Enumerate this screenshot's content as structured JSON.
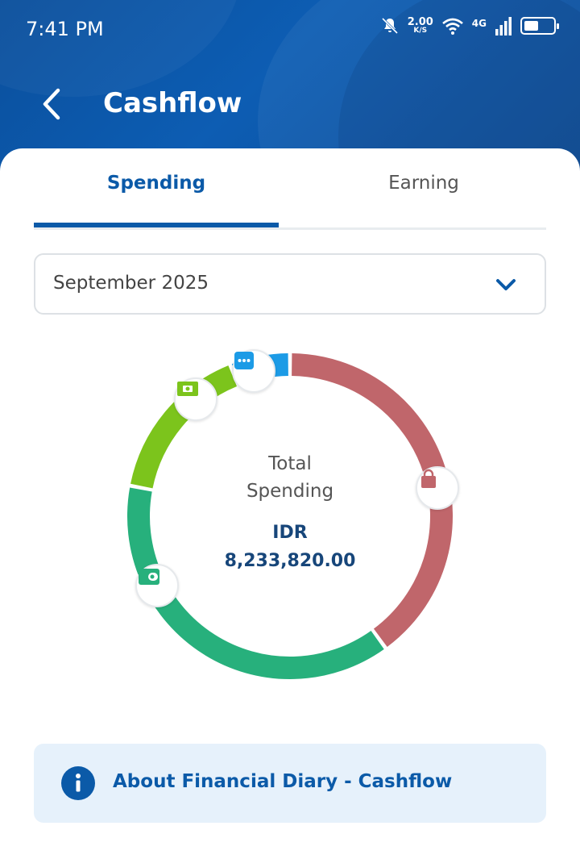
{
  "status_bar": {
    "time": "7:41 PM",
    "speed_value": "2.00",
    "speed_unit": "K/S",
    "network": "4G"
  },
  "header": {
    "title": "Cashflow",
    "back_icon": "chevron-left-icon"
  },
  "tabs": [
    {
      "label": "Spending",
      "active": true
    },
    {
      "label": "Earning",
      "active": false
    }
  ],
  "month_selector": {
    "value": "September 2025",
    "icon": "chevron-down-icon"
  },
  "summary": {
    "title_line1": "Total",
    "title_line2": "Spending",
    "currency": "IDR",
    "amount": "8,233,820.00"
  },
  "chart_data": {
    "type": "pie",
    "slices": [
      {
        "category_icon": "shopping-bag-icon",
        "share": 0.4,
        "color": "#c0666b"
      },
      {
        "category_icon": "wallet-icon",
        "share": 0.38,
        "color": "#27b07c"
      },
      {
        "category_icon": "cash-icon",
        "share": 0.16,
        "color": "#7cc41c"
      },
      {
        "category_icon": "more-icon",
        "share": 0.06,
        "color": "#1c9be6"
      }
    ]
  },
  "info_banner": {
    "label": "About Financial Diary - Cashflow",
    "icon": "info-icon"
  },
  "colors": {
    "brand": "#0b5aa8",
    "header_bg": "#0d5db3",
    "amount_text": "#17467a"
  }
}
